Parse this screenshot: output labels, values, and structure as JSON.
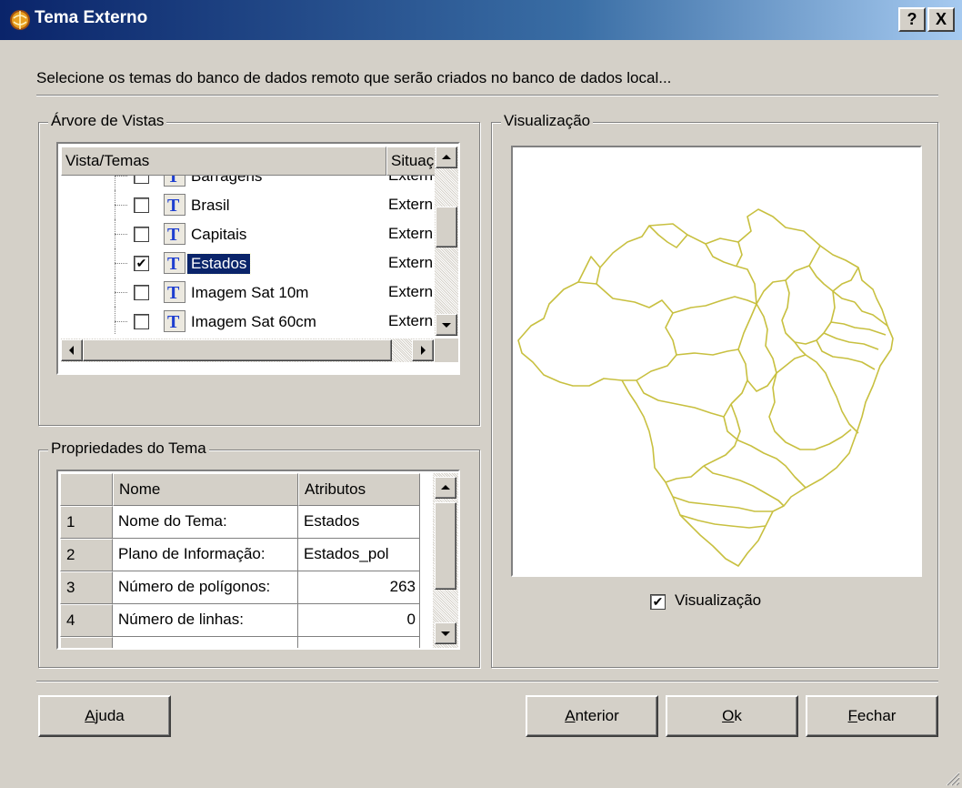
{
  "window": {
    "title": "Tema Externo",
    "help_glyph": "?",
    "close_glyph": "X"
  },
  "instruction": "Selecione os temas do banco de dados remoto que serão criados no banco de dados local...",
  "tree_group": {
    "legend": "Árvore de Vistas",
    "columns": [
      "Vista/Temas",
      "Situaç"
    ],
    "rows": [
      {
        "label": "Barragens",
        "status": "Extern",
        "checked": false,
        "selected": false
      },
      {
        "label": "Brasil",
        "status": "Extern",
        "checked": false,
        "selected": false
      },
      {
        "label": "Capitais",
        "status": "Extern",
        "checked": false,
        "selected": false
      },
      {
        "label": "Estados",
        "status": "Extern",
        "checked": true,
        "selected": true
      },
      {
        "label": "Imagem Sat 10m",
        "status": "Extern",
        "checked": false,
        "selected": false
      },
      {
        "label": "Imagem Sat 60cm",
        "status": "Extern",
        "checked": false,
        "selected": false
      }
    ],
    "theme_icon_letter": "T",
    "check_glyph": "✔"
  },
  "props_group": {
    "legend": "Propriedades do Tema",
    "columns": [
      "Nome",
      "Atributos"
    ],
    "rows": [
      {
        "index": "1",
        "name": "Nome do Tema:",
        "value": "Estados"
      },
      {
        "index": "2",
        "name": "Plano de Informação:",
        "value": "Estados_pol"
      },
      {
        "index": "3",
        "name": "Número de polígonos:",
        "value": "263"
      },
      {
        "index": "4",
        "name": "Número de linhas:",
        "value": "0"
      }
    ]
  },
  "preview_group": {
    "legend": "Visualização",
    "checkbox_label": "Visualização",
    "checkbox_checked": true,
    "map_stroke_color": "#c8c040"
  },
  "buttons": {
    "help": {
      "mnemonic": "A",
      "rest": "juda"
    },
    "previous": {
      "mnemonic": "A",
      "rest": "nterior"
    },
    "ok": {
      "mnemonic": "O",
      "rest": "k"
    },
    "close": {
      "mnemonic": "F",
      "rest": "echar"
    }
  },
  "colors": {
    "title_start": "#0a246a",
    "selection": "#0a246a",
    "face": "#d4d0c8",
    "theme_icon": "#1f3fd0"
  }
}
